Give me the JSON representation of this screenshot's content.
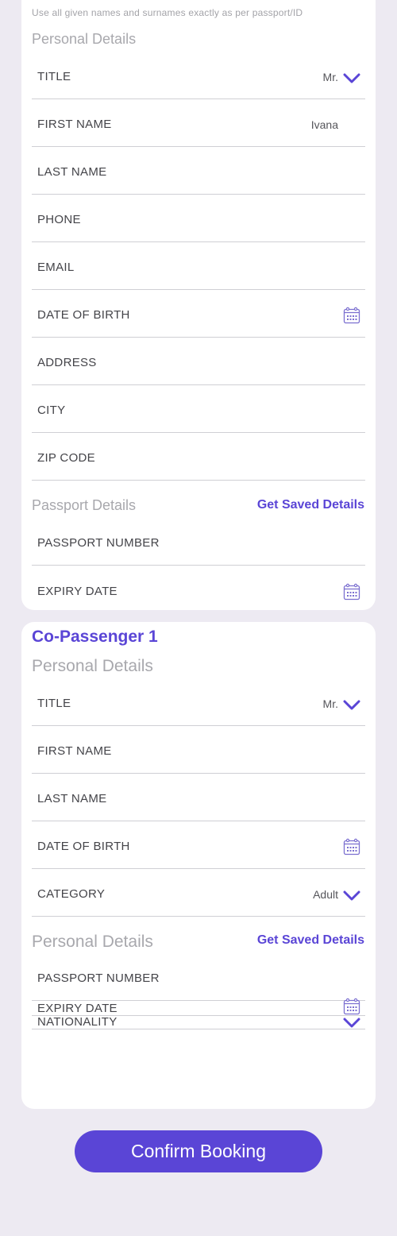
{
  "notice": "Use all given names and surnames exactly as per passport/ID",
  "main": {
    "personal_title": "Personal Details",
    "fields": {
      "title": "TITLE",
      "title_value": "Mr.",
      "first_name": "FIRST NAME",
      "first_name_value": "Ivana",
      "last_name": "LAST NAME",
      "phone": "PHONE",
      "email": "EMAIL",
      "dob": "DATE OF BIRTH",
      "address": "ADDRESS",
      "city": "CITY",
      "zip": "ZIP CODE"
    },
    "passport_title": "Passport Details",
    "get_saved": "Get Saved Details",
    "passport_fields": {
      "number": "PASSPORT NUMBER",
      "expiry": "EXPIRY DATE"
    }
  },
  "co_passenger": {
    "heading": "Co-Passenger 1",
    "personal_title": "Personal Details",
    "fields": {
      "title": "TITLE",
      "title_value": "Mr.",
      "first_name": "FIRST NAME",
      "last_name": "LAST NAME",
      "dob": "DATE OF BIRTH",
      "category": "CATEGORY",
      "category_value": "Adult"
    },
    "second_title": "Personal Details",
    "get_saved": "Get Saved Details",
    "passport_fields": {
      "number": "PASSPORT NUMBER",
      "expiry": "EXPIRY DATE",
      "nationality": "NATIONALITY"
    }
  },
  "confirm_label": "Confirm Booking",
  "colors": {
    "accent": "#5a45d6",
    "background": "#edeaf2",
    "muted": "#a8a8ad"
  },
  "icons": [
    "chevron-down-icon",
    "calendar-icon"
  ]
}
